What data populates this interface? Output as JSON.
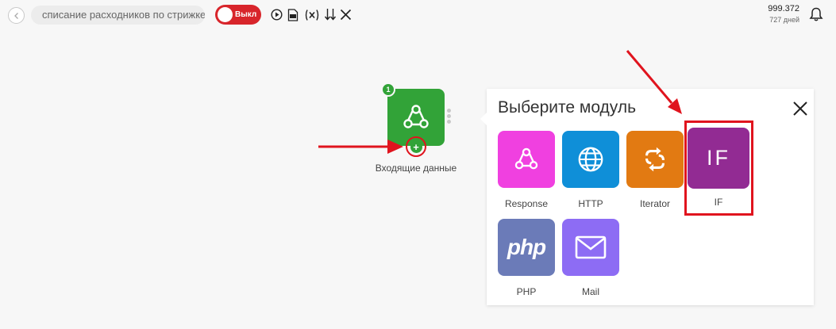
{
  "topbar": {
    "scenario_name": "списание расходников по стрижке",
    "toggle_label": "Выкл",
    "ops_count": "999.372",
    "days_left": "727 дней"
  },
  "module": {
    "badge": "1",
    "label": "Входящие данные",
    "color": "#32a338"
  },
  "picker": {
    "title": "Выберите модуль",
    "tiles": [
      {
        "name": "Response",
        "color": "#f040e0",
        "icon": "webhook-icon"
      },
      {
        "name": "HTTP",
        "color": "#0f8fd8",
        "icon": "globe-icon"
      },
      {
        "name": "Iterator",
        "color": "#e27a12",
        "icon": "iterator-icon"
      },
      {
        "name": "IF",
        "color": "#922b93",
        "icon_text": "IF"
      },
      {
        "name": "PHP",
        "color": "#6b7bb8",
        "icon_text": "php"
      },
      {
        "name": "Mail",
        "color": "#8d6cf4",
        "icon": "envelope-icon"
      }
    ]
  },
  "annotation_color": "#e0141e"
}
